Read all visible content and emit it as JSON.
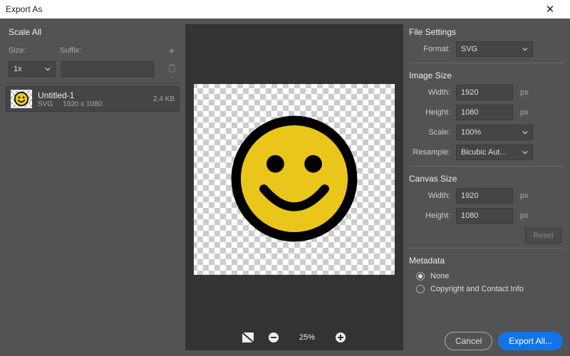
{
  "window": {
    "title": "Export As"
  },
  "left": {
    "scale_all_title": "Scale All",
    "size_label": "Size:",
    "suffix_label": "Suffix:",
    "size_value": "1x",
    "suffix_value": "",
    "file": {
      "name": "Untitled-1",
      "format": "SVG",
      "dimensions": "1920 x 1080",
      "size": "2.4 KB"
    }
  },
  "preview": {
    "zoom": "25%"
  },
  "right": {
    "file_settings_title": "File Settings",
    "format_label": "Format:",
    "format_value": "SVG",
    "image_size_title": "Image Size",
    "width_label": "Width:",
    "width_value": "1920",
    "height_label": "Height:",
    "height_value": "1080",
    "scale_label": "Scale:",
    "scale_value": "100%",
    "resample_label": "Resample:",
    "resample_value": "Bicubic Aut...",
    "px": "px",
    "canvas_size_title": "Canvas Size",
    "canvas_width_value": "1920",
    "canvas_height_value": "1080",
    "reset_label": "Reset",
    "metadata_title": "Metadata",
    "metadata_none": "None",
    "metadata_copyright": "Copyright and Contact Info"
  },
  "footer": {
    "cancel": "Cancel",
    "export": "Export All..."
  }
}
